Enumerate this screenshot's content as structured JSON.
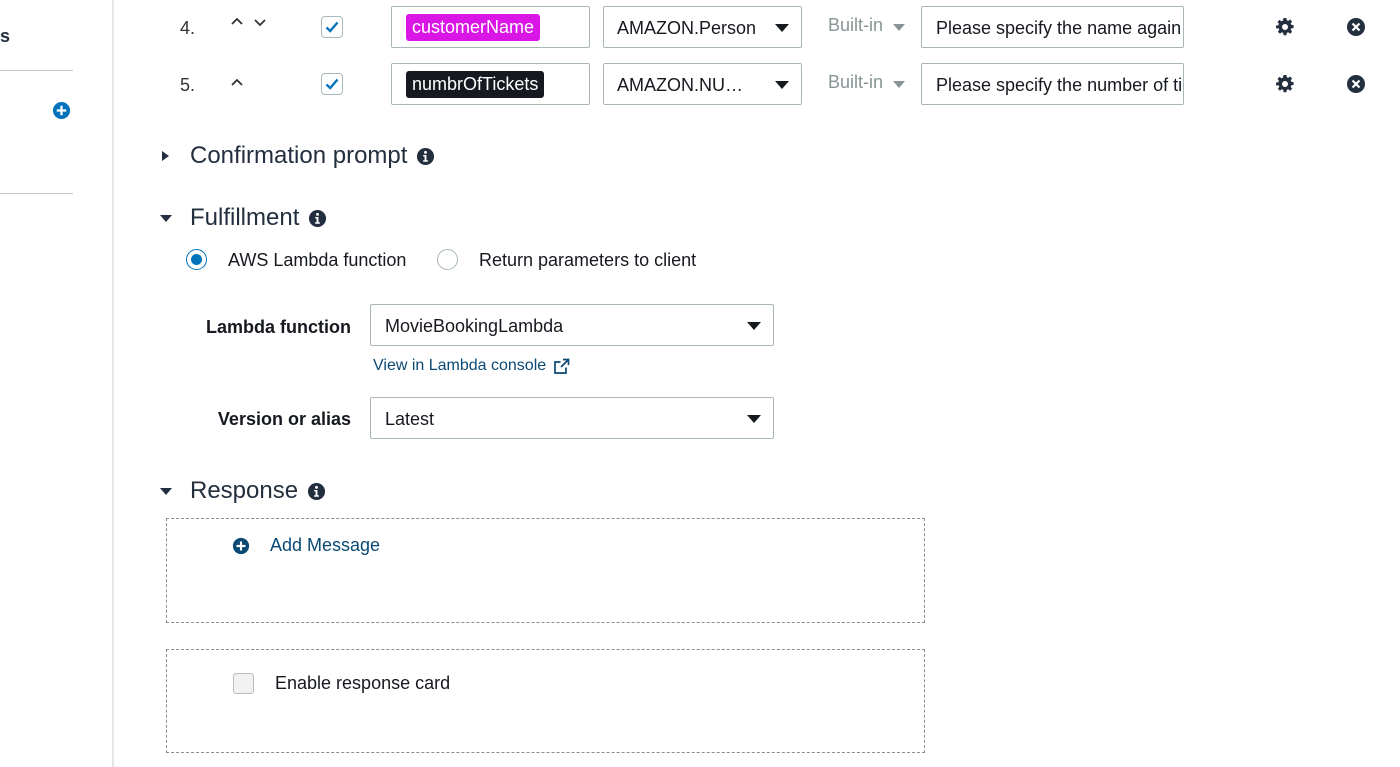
{
  "sidebar": {
    "clipped_label": "s"
  },
  "slots": [
    {
      "priority": "4.",
      "name": "customerName",
      "tag_color": "#d916e6",
      "type": "AMAZON.Person",
      "source": "Built-in",
      "prompt": "Please specify the name again"
    },
    {
      "priority": "5.",
      "name": "numbrOfTickets",
      "tag_color": "#16191f",
      "type": "AMAZON.NU…",
      "source": "Built-in",
      "prompt": "Please specify the number of tickets"
    }
  ],
  "confirmation": {
    "title": "Confirmation prompt"
  },
  "fulfillment": {
    "title": "Fulfillment",
    "option_lambda": "AWS Lambda function",
    "option_client": "Return parameters to client",
    "lambda_label": "Lambda function",
    "lambda_value": "MovieBookingLambda",
    "console_link": "View in Lambda console",
    "version_label": "Version or alias",
    "version_value": "Latest"
  },
  "response": {
    "title": "Response",
    "add_message": "Add Message",
    "card_label": "Enable response card"
  },
  "colors": {
    "accent": "#0073bb",
    "link": "#0a4a74"
  }
}
